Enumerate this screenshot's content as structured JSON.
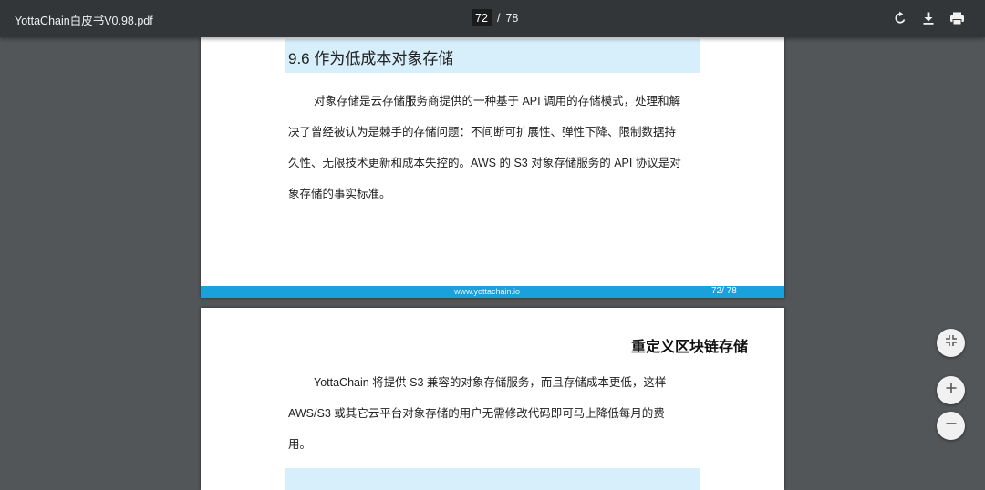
{
  "toolbar": {
    "title": "YottaChain白皮书V0.98.pdf",
    "current_page": "72",
    "separator": "/",
    "total_pages": "78",
    "icons": [
      "rotate-icon",
      "download-icon",
      "print-icon"
    ]
  },
  "page1": {
    "heading": "9.6 作为低成本对象存储",
    "paragraph_lines": [
      "对象存储是云存储服务商提供的一种基于 API 调用的存储模式，处理和解",
      "决了曾经被认为是棘手的存储问题：不间断可扩展性、弹性下降、限制数据持",
      "久性、无限技术更新和成本失控的。AWS 的 S3 对象存储服务的 API 协议是对",
      "象存储的事实标准。"
    ],
    "footer_url": "www.yottachain.io",
    "footer_page": "72/  78"
  },
  "page2": {
    "running_header": "重定义区块链存储",
    "paragraph_lines": [
      "YottaChain 将提供 S3 兼容的对象存储服务，而且存储成本更低，这样",
      "AWS/S3 或其它云平台对象存储的用户无需修改代码即可马上降低每月的费",
      "用。"
    ]
  },
  "zoom_controls": {
    "icons": [
      "fit-page-icon",
      "zoom-in-icon",
      "zoom-out-icon"
    ]
  },
  "colors": {
    "toolbar": "#323639",
    "background": "#525659",
    "heading_band": "#d7eefb",
    "footer_bar": "#1aa1dc"
  }
}
